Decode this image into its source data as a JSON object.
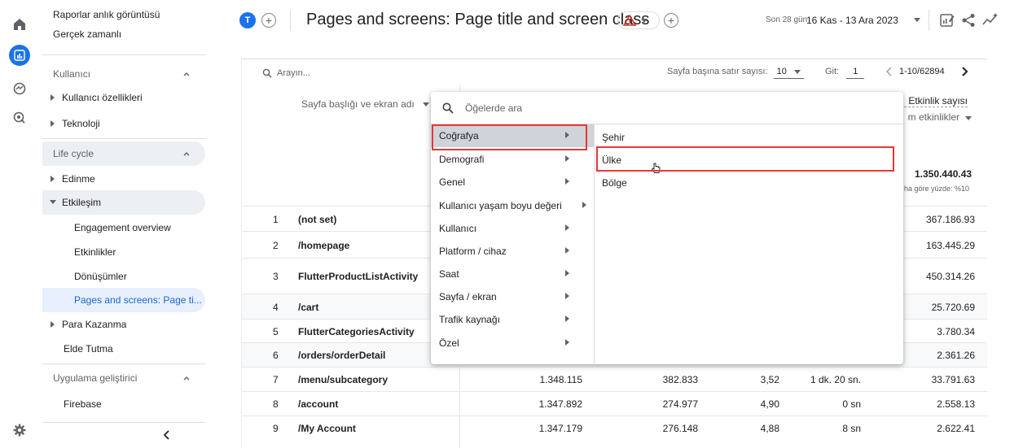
{
  "sidebar": {
    "top_items": [
      "Raporlar anlık görüntüsü",
      "Gerçek zamanlı"
    ],
    "sections": [
      {
        "label": "Kullanıcı",
        "items": [
          "Kullanıcı özellikleri",
          "Teknoloji"
        ]
      },
      {
        "label": "Life cycle",
        "items": [
          "Edinme",
          "Etkileşim",
          "Engagement overview",
          "Etkinlikler",
          "Dönüşümler",
          "Pages and screens: Page ti...",
          "Para Kazanma",
          "Elde Tutma"
        ]
      },
      {
        "label": "Uygulama geliştirici",
        "items": [
          "Firebase"
        ]
      }
    ]
  },
  "header": {
    "avatar_letter": "T",
    "title": "Pages and screens: Page title and screen class",
    "date_label": "Son 28 gün",
    "date_range": "16 Kas - 13 Ara 2023"
  },
  "table_controls": {
    "search_placeholder": "Arayın...",
    "rows_per_page_label": "Sayfa başına satır sayısı:",
    "rows_per_page": "10",
    "goto_label": "Git:",
    "goto_value": "1",
    "range": "1-10/62894",
    "dimension_header": "Sayfa başlığı ve ekran adı",
    "metric_header": "Etkinlik sayısı",
    "metric_sub": "m etkinlikler",
    "total_value": "1.350.440.43",
    "total_sub": "ha göre yüzde: %10"
  },
  "rows": [
    {
      "idx": "1",
      "name": "(not set)",
      "c1": "",
      "c2": "",
      "c3": "",
      "c4": "",
      "c5": "367.186.93"
    },
    {
      "idx": "2",
      "name": "/homepage",
      "c1": "",
      "c2": "",
      "c3": "",
      "c4": "",
      "c5": "163.445.29"
    },
    {
      "idx": "3",
      "name": "FlutterProductListActivity",
      "c1": "",
      "c2": "",
      "c3": "",
      "c4": "",
      "c5": "450.314.26"
    },
    {
      "idx": "4",
      "name": "/cart",
      "c1": "",
      "c2": "",
      "c3": "",
      "c4": "",
      "c5": "25.720.69"
    },
    {
      "idx": "5",
      "name": "FlutterCategoriesActivity",
      "c1": "",
      "c2": "",
      "c3": "",
      "c4": "",
      "c5": "3.780.34"
    },
    {
      "idx": "6",
      "name": "/orders/orderDetail",
      "c1": "",
      "c2": "",
      "c3": "",
      "c4": "",
      "c5": "2.361.26"
    },
    {
      "idx": "7",
      "name": "/menu/subcategory",
      "c1": "1.348.115",
      "c2": "382.833",
      "c3": "3,52",
      "c4": "1 dk. 20 sn.",
      "c5": "33.791.63"
    },
    {
      "idx": "8",
      "name": "/account",
      "c1": "1.347.892",
      "c2": "274.977",
      "c3": "4,90",
      "c4": "0 sn",
      "c5": "2.558.13"
    },
    {
      "idx": "9",
      "name": "/My Account",
      "c1": "1.347.179",
      "c2": "276.148",
      "c3": "4,88",
      "c4": "8 sn",
      "c5": "2.622.41"
    }
  ],
  "popup": {
    "search_placeholder": "Öğelerde ara",
    "categories": [
      "Coğrafya",
      "Demografi",
      "Genel",
      "Kullanıcı yaşam boyu değeri",
      "Kullanıcı",
      "Platform / cihaz",
      "Saat",
      "Sayfa / ekran",
      "Trafik kaynağı",
      "Özel"
    ],
    "sub_items": [
      "Şehir",
      "Ülke",
      "Bölge"
    ]
  },
  "colors": {
    "accent": "#1a73e8",
    "highlight_red": "#e53935",
    "selected_bg": "#cfd3da"
  }
}
